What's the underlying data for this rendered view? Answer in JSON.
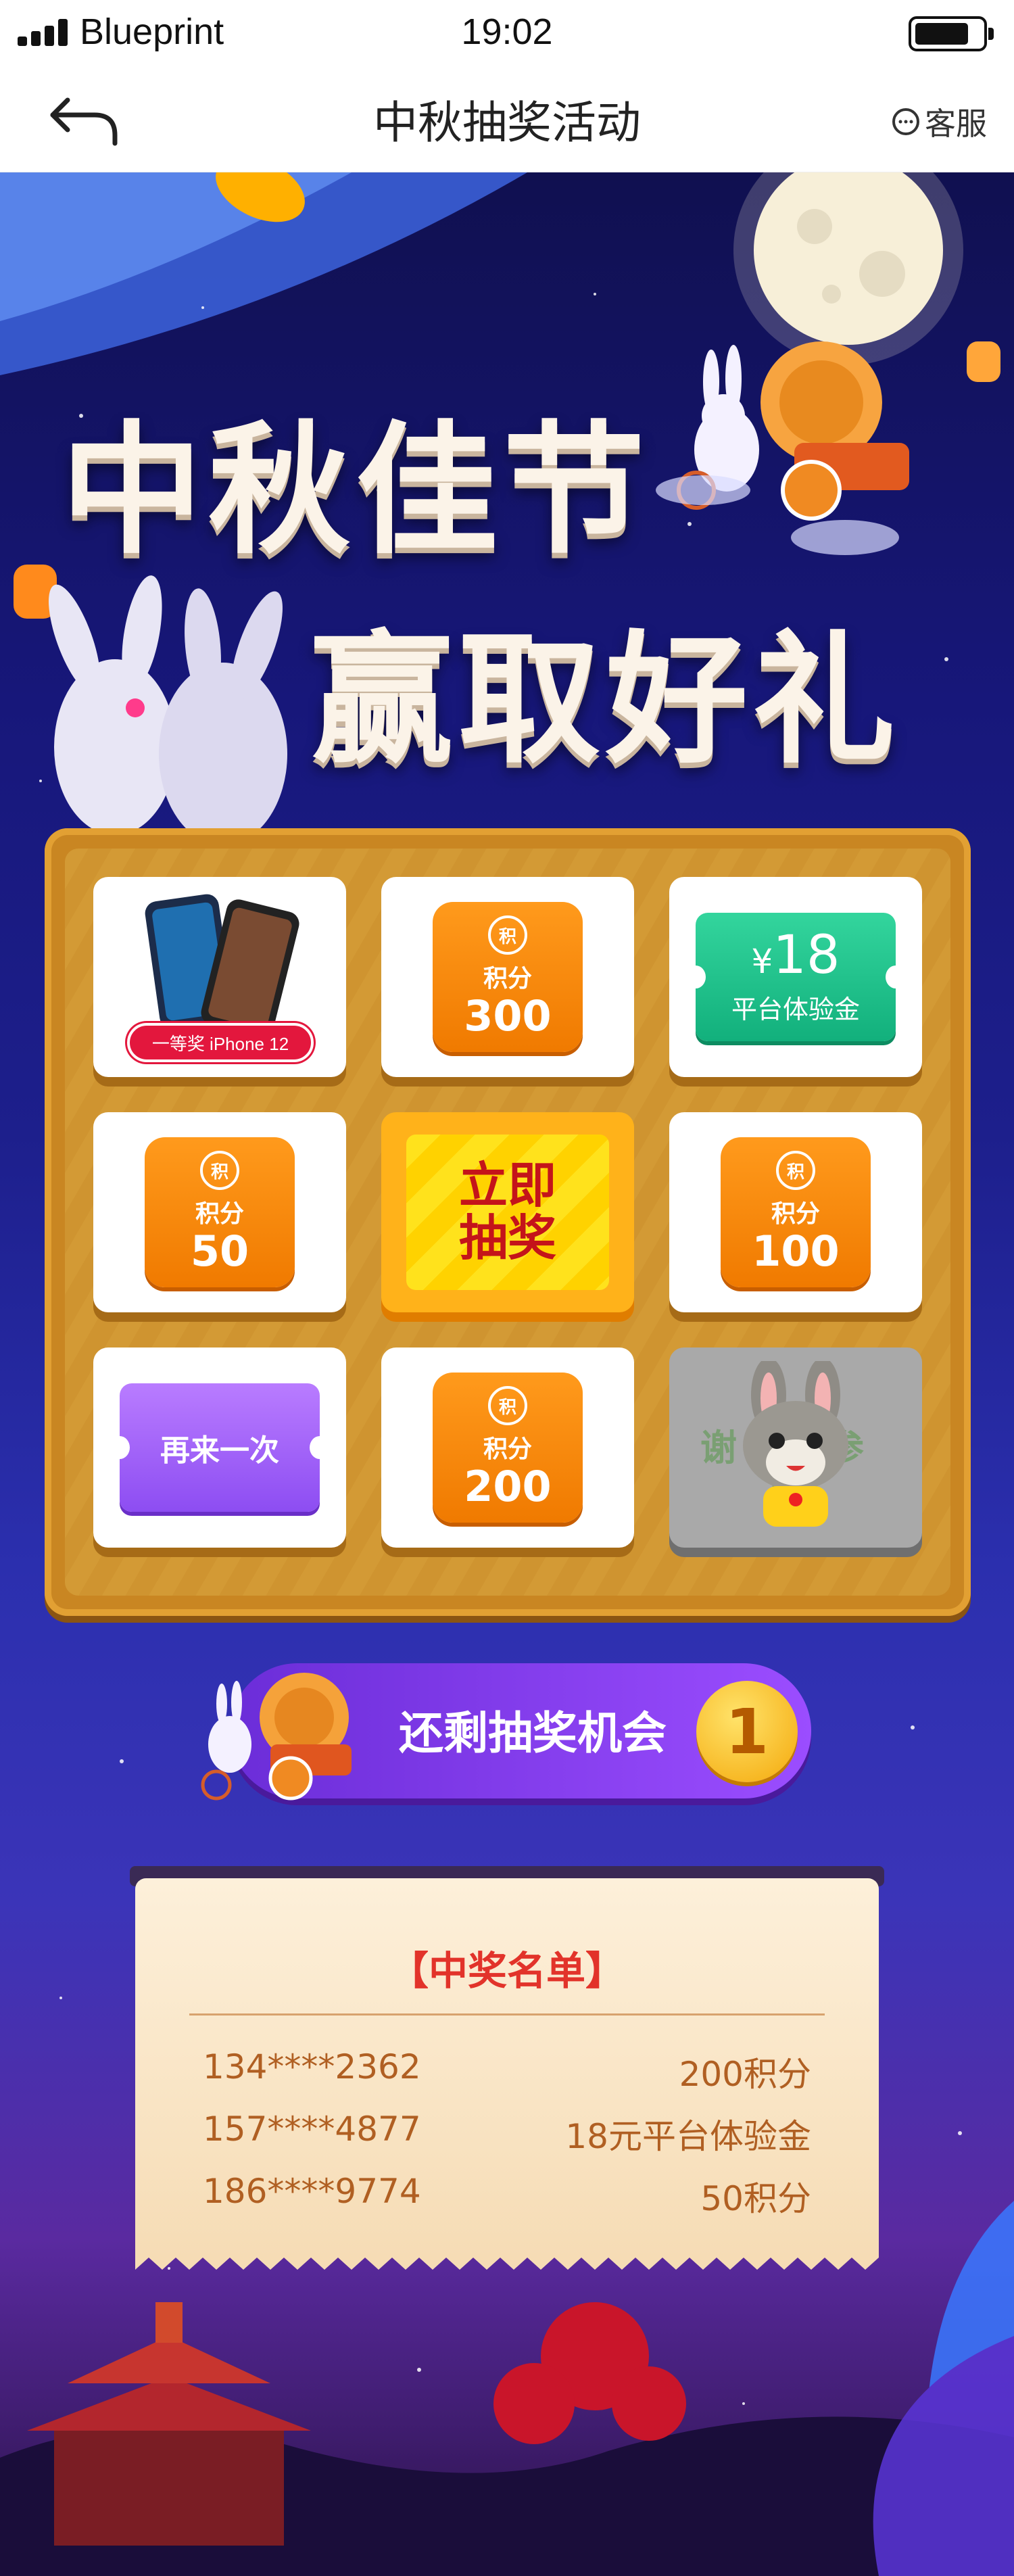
{
  "status_bar": {
    "carrier": "Blueprint",
    "time": "19:02"
  },
  "nav": {
    "title": "中秋抽奖活动",
    "service_label": "客服"
  },
  "hero": {
    "line1": "中秋佳节",
    "line2": "赢取好礼"
  },
  "board": {
    "first_prize_label": "一等奖 iPhone 12",
    "coin_badge": "积",
    "points_label": "积分",
    "points_300": "300",
    "voucher_amount": "18",
    "voucher_currency": "¥",
    "voucher_desc": "平台体验金",
    "points_50": "50",
    "draw_line1": "立即",
    "draw_line2": "抽奖",
    "points_100": "100",
    "retry_label": "再来一次",
    "points_200": "200",
    "thanks_label": "谢谢参与"
  },
  "chances": {
    "label": "还剩抽奖机会",
    "count": "1"
  },
  "winners": {
    "title": "【中奖名单】",
    "rows": [
      {
        "phone": "134****2362",
        "prize": "200积分"
      },
      {
        "phone": "157****4877",
        "prize": "18元平台体验金"
      },
      {
        "phone": "186****9774",
        "prize": "50积分"
      }
    ]
  },
  "colors": {
    "background": "#1b1464",
    "board": "#c98622",
    "points_orange": "#f07a00",
    "voucher_green": "#12b07c",
    "retry_purple": "#8d4df2",
    "draw_yellow": "#ffd200",
    "draw_text_red": "#c4141a",
    "winners_title_red": "#e2332a"
  },
  "icons": [
    "signal-icon",
    "battery-icon",
    "back-arrow-icon",
    "chat-bubble-icon",
    "moon-icon",
    "rabbit-icon",
    "mooncake-icon",
    "lantern-icon",
    "iphone-icon"
  ]
}
